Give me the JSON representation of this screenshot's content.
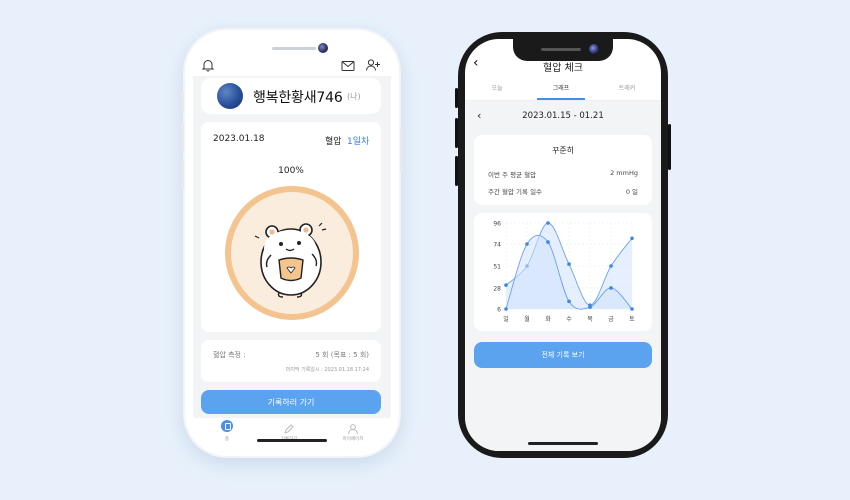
{
  "left_phone": {
    "profile": {
      "nickname": "행복한황새746",
      "tag": "(나)"
    },
    "card": {
      "date": "2023.01.18",
      "measure_label": "혈압",
      "day_label": "1일차",
      "progress_text": "100%",
      "progress": 1.0
    },
    "stats": {
      "label": "혈압 측정 :",
      "value": "5 회 (목표 : 5 회)",
      "last_record": "마지막 기록일시 : 2023.01.18 17:24"
    },
    "cta_button": "기록하러 가기",
    "tabs": [
      "홈",
      "기록하기",
      "마이페이지"
    ],
    "icons": [
      "bell-icon",
      "mail-icon",
      "add-user-icon",
      "home-icon",
      "pencil-icon",
      "user-icon"
    ]
  },
  "right_phone": {
    "title": "혈압 체크",
    "tabs": [
      "오늘",
      "그래프",
      "트래커"
    ],
    "active_tab": "그래프",
    "week_range": "2023.01.15 - 01.21",
    "summary": {
      "title": "꾸준히",
      "rows": [
        {
          "label": "이번 주 평균 혈압",
          "value": "2 mmHg"
        },
        {
          "label": "주간 혈압 기록 일수",
          "value": "0 일"
        }
      ]
    },
    "cta_button": "전체 기록 보기",
    "icons": [
      "back-arrow-icon",
      "chevron-left-icon"
    ]
  },
  "chart_data": {
    "type": "line",
    "categories": [
      "일",
      "월",
      "화",
      "수",
      "목",
      "금",
      "토"
    ],
    "yticks": [
      96,
      74,
      51,
      28,
      6
    ],
    "ylim": [
      6,
      96
    ],
    "grid": true,
    "series": [
      {
        "values": [
          31,
          51,
          96,
          53,
          10,
          51,
          80
        ]
      },
      {
        "values": [
          6,
          74,
          76,
          14,
          8,
          28,
          6
        ]
      }
    ],
    "colors": {
      "line": "#4a8ee6",
      "fill": "#cfe2fb",
      "point": "#3f86e0"
    }
  }
}
